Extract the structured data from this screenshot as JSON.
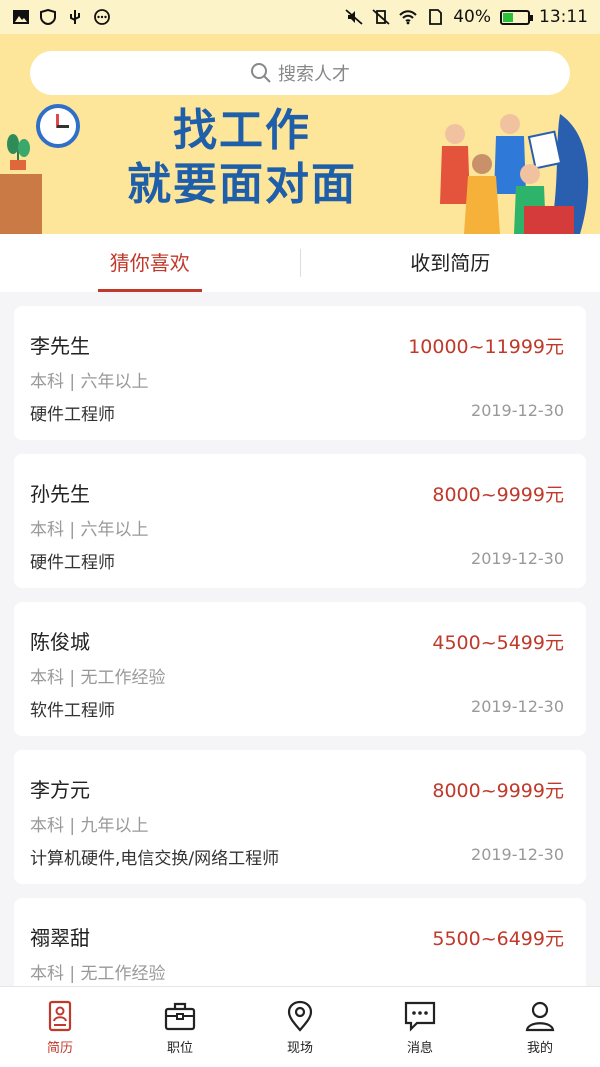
{
  "status": {
    "battery": "40%",
    "battery_level": 0.4,
    "time": "13:11",
    "icons_left": [
      "image-icon",
      "shield-icon",
      "usb-icon",
      "more-icon"
    ],
    "icons_right": [
      "mute-icon",
      "vibrate-off-icon",
      "wifi-icon",
      "sim-icon",
      "battery-icon"
    ]
  },
  "search": {
    "placeholder": "搜索人才"
  },
  "banner": {
    "line1": "找工作",
    "line2": "就要面对面"
  },
  "tabs": [
    {
      "label": "猜你喜欢",
      "active": true
    },
    {
      "label": "收到简历",
      "active": false
    }
  ],
  "resumes": [
    {
      "name": "李先生",
      "salary": "10000~11999元",
      "education": "本科 | 六年以上",
      "job": "硬件工程师",
      "date": "2019-12-30"
    },
    {
      "name": "孙先生",
      "salary": "8000~9999元",
      "education": "本科 | 六年以上",
      "job": "硬件工程师",
      "date": "2019-12-30"
    },
    {
      "name": "陈俊城",
      "salary": "4500~5499元",
      "education": "本科 | 无工作经验",
      "job": "软件工程师",
      "date": "2019-12-30"
    },
    {
      "name": "李方元",
      "salary": "8000~9999元",
      "education": "本科 | 九年以上",
      "job": "计算机硬件,电信交换/网络工程师",
      "date": "2019-12-30"
    },
    {
      "name": "禤翠甜",
      "salary": "5500~6499元",
      "education": "本科 | 无工作经验",
      "job": "",
      "date": ""
    }
  ],
  "nav": [
    {
      "label": "简历",
      "icon": "resume-icon",
      "active": true
    },
    {
      "label": "职位",
      "icon": "briefcase-icon",
      "active": false
    },
    {
      "label": "现场",
      "icon": "location-icon",
      "active": false
    },
    {
      "label": "消息",
      "icon": "message-icon",
      "active": false
    },
    {
      "label": "我的",
      "icon": "user-icon",
      "active": false
    }
  ],
  "colors": {
    "accent": "#c0392b",
    "banner": "#fde69a",
    "slogan": "#1f5ea8"
  }
}
